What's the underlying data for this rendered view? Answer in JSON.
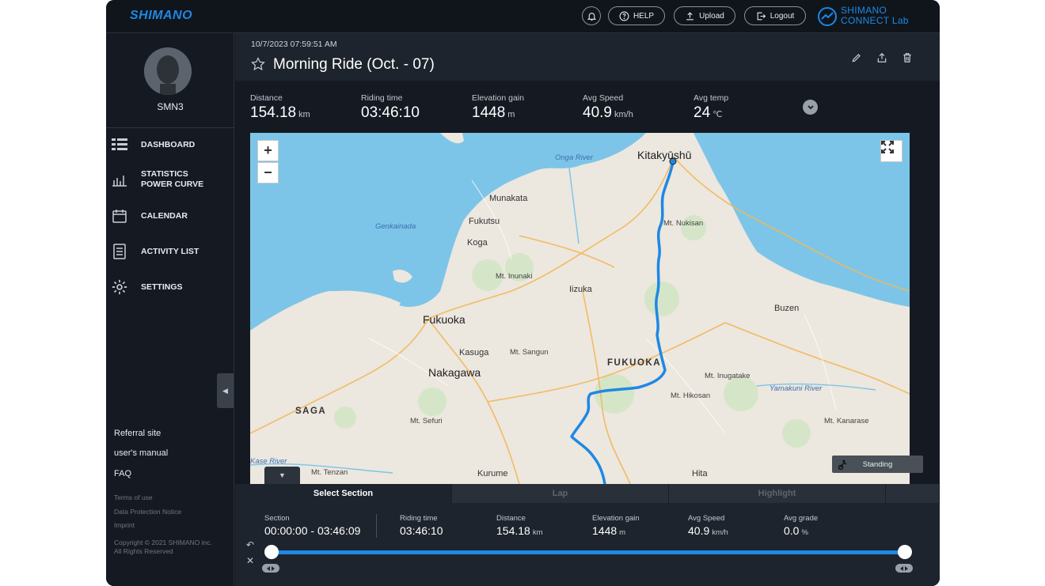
{
  "header": {
    "brand": "SHIMANO",
    "help_label": "HELP",
    "upload_label": "Upload",
    "logout_label": "Logout",
    "connect_line1": "SHIMANO",
    "connect_line2": "CONNECT Lab"
  },
  "user": {
    "name": "SMN3"
  },
  "sidebar": {
    "items": [
      {
        "label": "DASHBOARD",
        "icon": "dashboard-icon"
      },
      {
        "label": "STATISTICS POWER CURVE",
        "icon": "chart-icon"
      },
      {
        "label": "CALENDAR",
        "icon": "calendar-icon"
      },
      {
        "label": "ACTIVITY LIST",
        "icon": "list-icon"
      },
      {
        "label": "SETTINGS",
        "icon": "gear-icon"
      }
    ],
    "links": [
      "Referral site",
      "user's manual",
      "FAQ"
    ],
    "small_links": [
      "Terms of use",
      "Data Protection Notice",
      "Imprint"
    ],
    "copyright_line1": "Copyright © 2021 SHIMANO inc.",
    "copyright_line2": "All Rights Reserved"
  },
  "activity": {
    "timestamp": "10/7/2023 07:59:51 AM",
    "title": "Morning Ride (Oct. - 07)"
  },
  "stats": [
    {
      "label": "Distance",
      "value": "154.18",
      "unit": "km"
    },
    {
      "label": "Riding time",
      "value": "03:46:10",
      "unit": ""
    },
    {
      "label": "Elevation gain",
      "value": "1448",
      "unit": "m"
    },
    {
      "label": "Avg Speed",
      "value": "40.9",
      "unit": "km/h"
    },
    {
      "label": "Avg temp",
      "value": "24",
      "unit": "℃"
    }
  ],
  "map": {
    "zoom_in": "+",
    "zoom_out": "−",
    "places": {
      "kitakyushu": "Kitakyūshū",
      "onga_river": "Onga River",
      "munakata": "Munakata",
      "fukutsu": "Fukutsu",
      "genkainada": "Genkainada",
      "koga": "Koga",
      "mt_nukisan": "Mt. Nukisan",
      "mt_inunaki": "Mt. Inunaki",
      "iizuka": "Iizuka",
      "fukuoka_city": "Fukuoka",
      "buzen": "Buzen",
      "kasuga": "Kasuga",
      "mt_sangun": "Mt. Sangun",
      "fukuoka_pref": "FUKUOKA",
      "nakagawa": "Nakagawa",
      "mt_inugatake": "Mt. Inugatake",
      "yamakuni_river": "Yamakuni River",
      "mt_hikosan": "Mt. Hikosan",
      "saga": "SAGA",
      "mt_sefuri": "Mt. Sefuri",
      "mt_kanarase": "Mt. Kanarase",
      "kase_river": "Kase River",
      "mt_tenzan": "Mt. Tenzan",
      "kurume": "Kurume",
      "hita": "Hita"
    },
    "standing_label": "Standing"
  },
  "section": {
    "tabs": [
      "Select Section",
      "Lap",
      "Highlight"
    ],
    "stats": [
      {
        "label": "Section",
        "value": "00:00:00 - 03:46:09",
        "unit": ""
      },
      {
        "label": "Riding time",
        "value": "03:46:10",
        "unit": ""
      },
      {
        "label": "Distance",
        "value": "154.18",
        "unit": "km"
      },
      {
        "label": "Elevation gain",
        "value": "1448",
        "unit": "m"
      },
      {
        "label": "Avg Speed",
        "value": "40.9",
        "unit": "km/h"
      },
      {
        "label": "Avg grade",
        "value": "0.0",
        "unit": "%"
      }
    ],
    "range_start": 0,
    "range_end": 1
  }
}
